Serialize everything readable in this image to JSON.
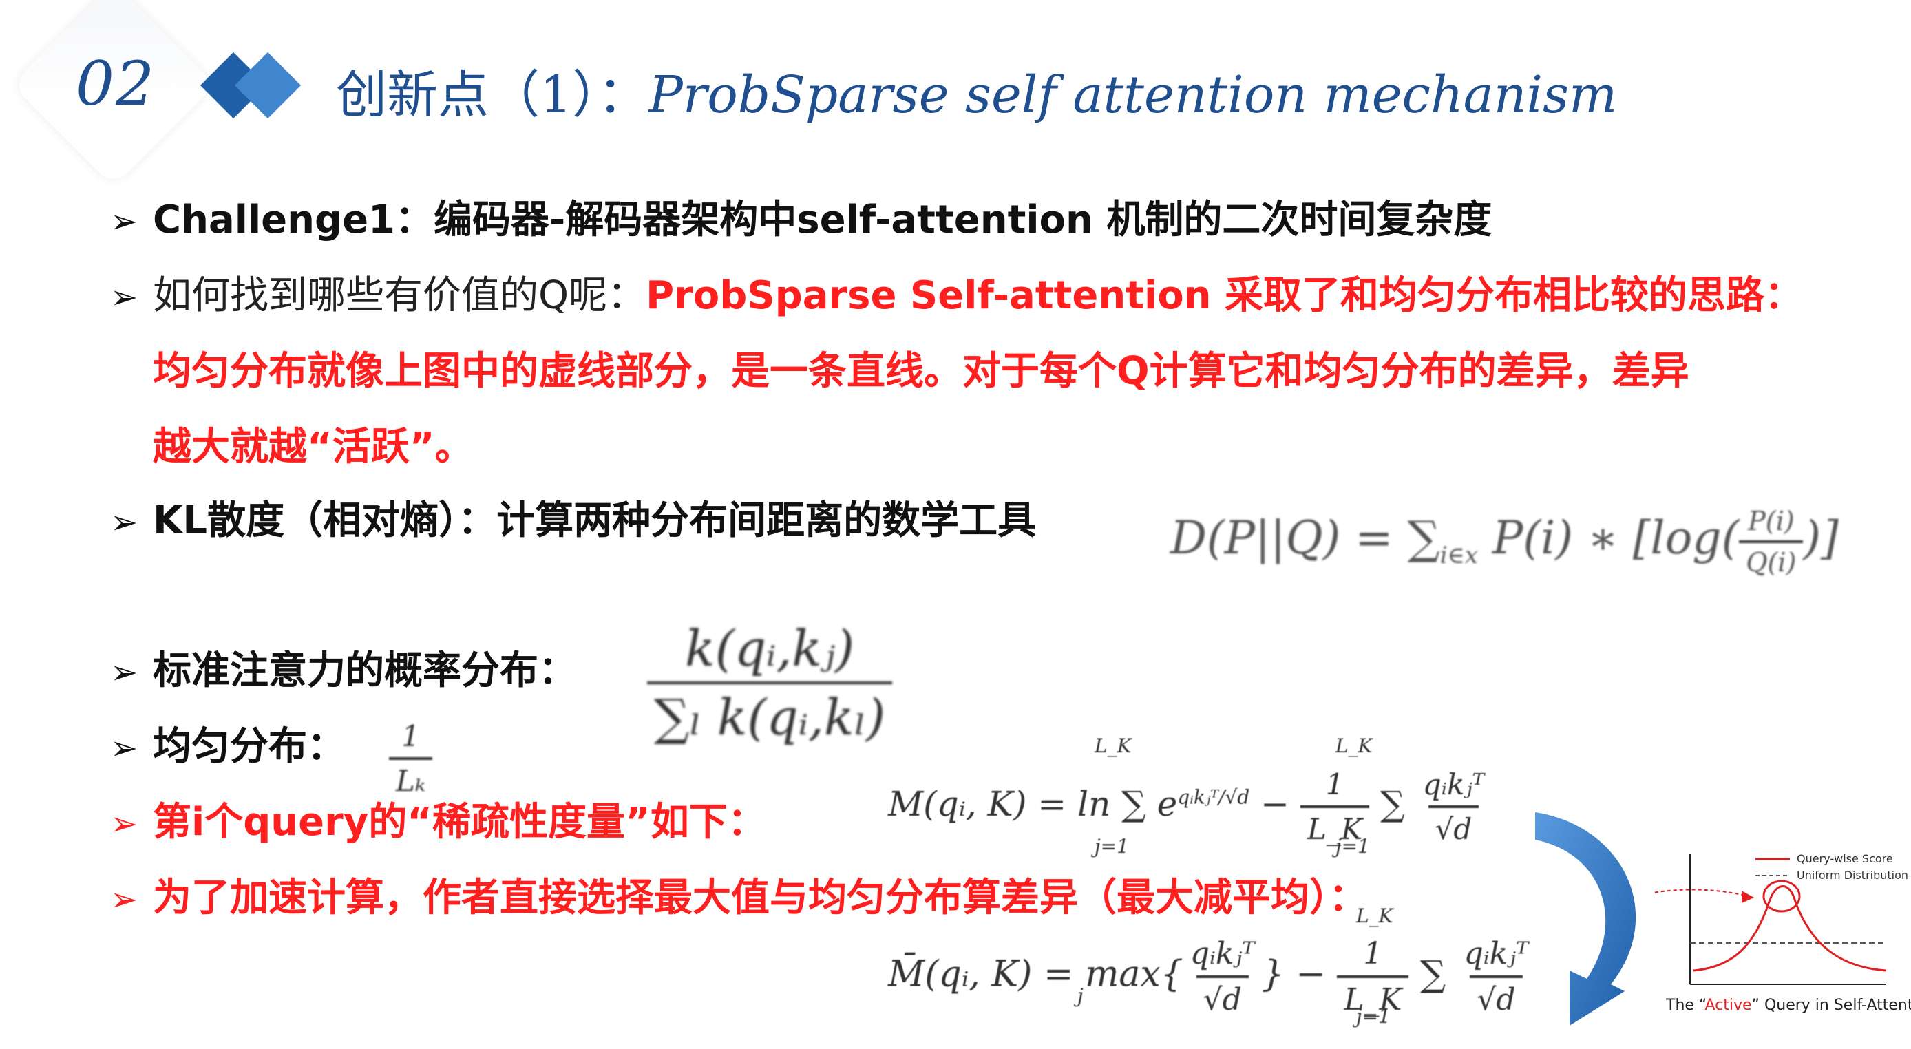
{
  "header": {
    "section_number": "02",
    "title_cn": "创新点（1）：",
    "title_en": "ProbSparse self attention mechanism"
  },
  "bullets": {
    "challenge": "Challenge1：编码器-解码器架构中self-attention 机制的二次时间复杂度",
    "question_plain": "如何找到哪些有价值的Q呢：",
    "question_red": "ProbSparse Self-attention 采取了和均匀分布相比较的思路：",
    "question_red_line2": "均匀分布就像上图中的虚线部分，是一条直线。对于每个Q计算它和均匀分布的差异，差异",
    "question_red_line3": "越大就越“活跃”。",
    "kl": "KL散度（相对熵）：计算两种分布间距离的数学工具",
    "std_attention": "标准注意力的概率分布：",
    "uniform": "均匀分布：",
    "sparsity": "第i个query的“稀疏性度量”如下：",
    "speedup": "为了加速计算，作者直接选择最大值与均匀分布算差异（最大减平均）："
  },
  "formulas": {
    "kl_lhs": "D(P||Q) = ∑",
    "kl_sub": "i∈x",
    "kl_rhs": " P(i) ∗ [log(",
    "kl_num": "P(i)",
    "kl_den": "Q(i)",
    "kl_end": ")]",
    "std_num": "k(qᵢ,kⱼ)",
    "std_den": "∑ₗ k(qᵢ,kₗ)",
    "uni_num": "1",
    "uni_den": "Lₖ",
    "m_lhs": "M(qᵢ, K) = ln ∑ e",
    "m_sup": "qᵢkⱼᵀ/√d",
    "m_mid": " − ",
    "m_frac_num": "1",
    "m_frac_den": "L_K",
    "m_sum": " ∑ ",
    "m_num": "qᵢkⱼᵀ",
    "m_den": "√d",
    "mbar_lhs": "M̄(qᵢ, K) = max{",
    "mbar_num": "qᵢkⱼᵀ",
    "mbar_den": "√d",
    "mbar_close": "} − ",
    "mbar_frac_num": "1",
    "mbar_frac_den": "L_K",
    "mbar_sum": " ∑ ",
    "mbar_num2": "qᵢkⱼᵀ",
    "mbar_den2": "√d",
    "j_eq_1": "j=1",
    "lk_top": "L_K",
    "j_sub": "j"
  },
  "figure": {
    "legend_score": "Query-wise Score",
    "legend_uniform": "Uniform Distribution",
    "caption_pre": "The “",
    "caption_active": "Active",
    "caption_post": "” Query in Self-Attention",
    "colors": {
      "score": "#e02020",
      "uniform": "#555555",
      "arrow": "#2f6fbf"
    }
  }
}
